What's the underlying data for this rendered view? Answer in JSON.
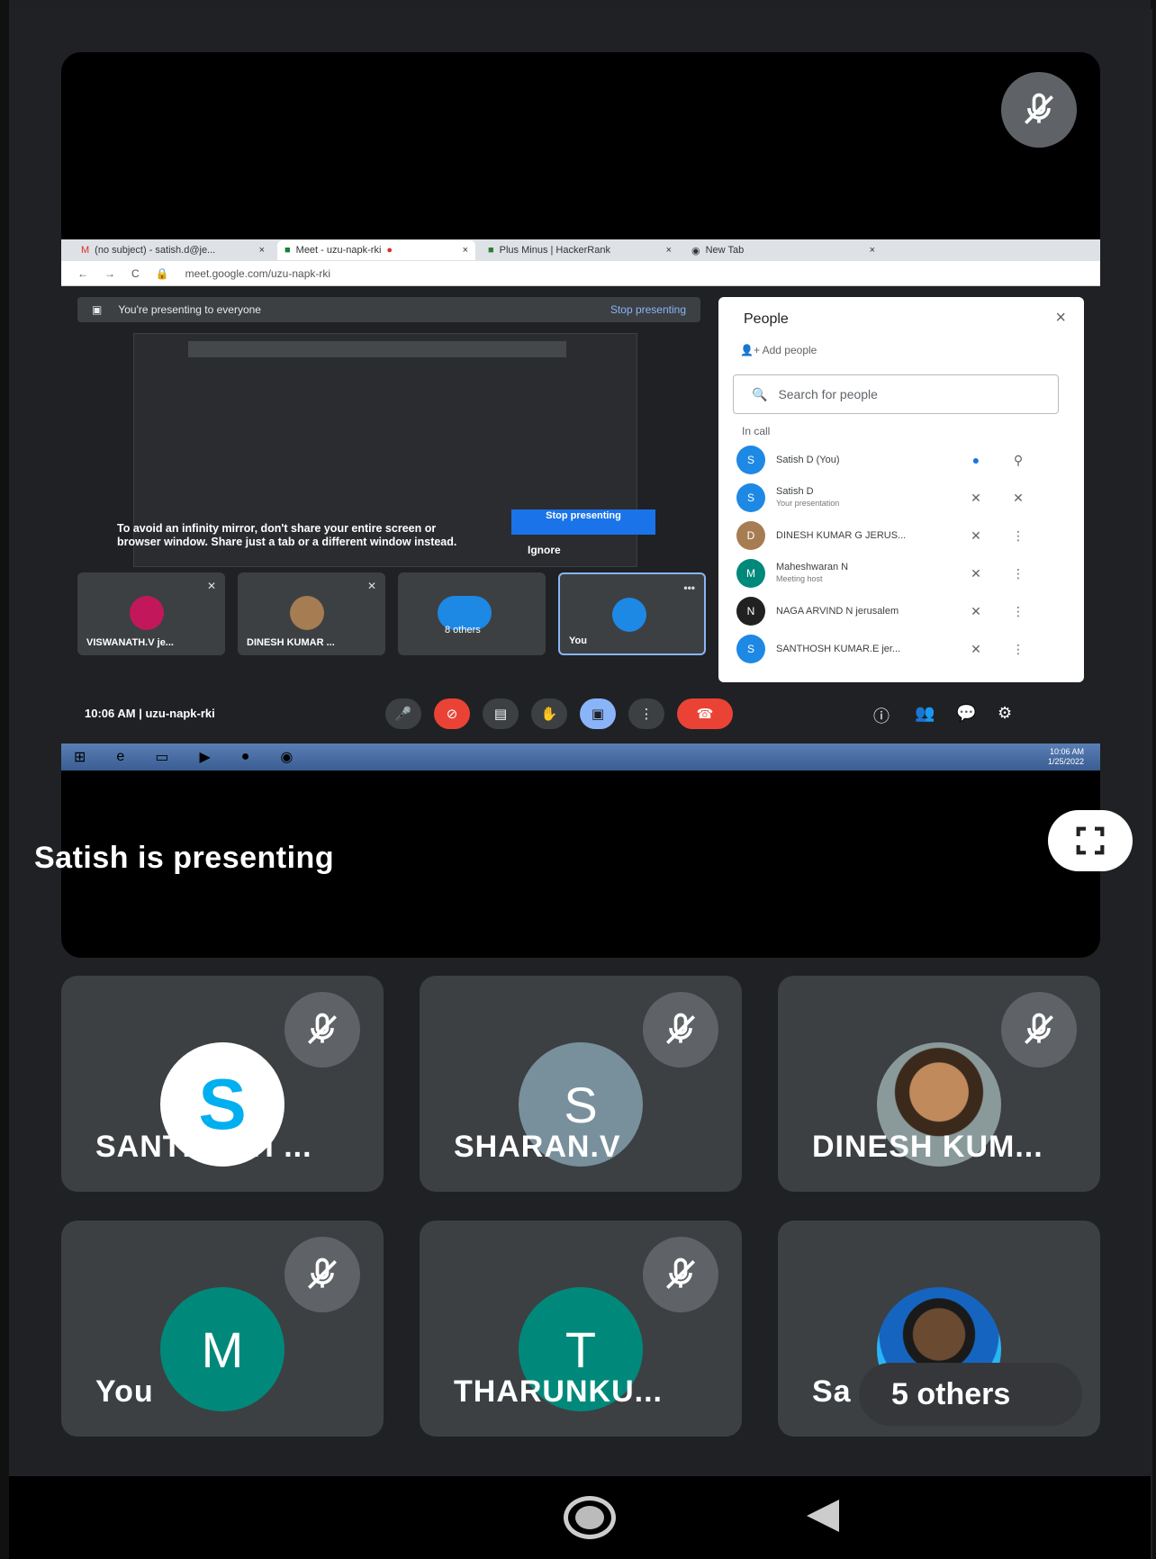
{
  "presentation": {
    "label": "Satish is presenting",
    "icons": {
      "mic": "mic-off-icon",
      "fullscreen": "fullscreen-icon"
    }
  },
  "browser": {
    "tabs": [
      {
        "label": "(no subject) - satish.d@je...",
        "close": "×"
      },
      {
        "label": "Meet - uzu-napk-rki",
        "close": "×"
      },
      {
        "label": "Plus Minus | HackerRank",
        "close": "×"
      },
      {
        "label": "New Tab",
        "close": "×"
      }
    ],
    "url": "meet.google.com/uzu-napk-rki",
    "nav": [
      "←",
      "→",
      "C"
    ]
  },
  "shared_meet": {
    "banner_text": "You're presenting to everyone",
    "banner_stop": "Stop presenting",
    "warning": "To avoid an infinity mirror, don't share your entire screen or browser window. Share just a tab or a different window instead.",
    "stop_button": "Stop presenting",
    "ignore": "Ignore",
    "mini_tiles": [
      {
        "name": "VISWANATH.V je...",
        "avatar_color": "#c2185b"
      },
      {
        "name": "DINESH KUMAR ...",
        "avatar_color": "#a67c52"
      },
      {
        "name": "8 others",
        "avatar_color": "#1e88e5"
      },
      {
        "name": "You",
        "avatar_color": "#1e88e5"
      }
    ],
    "meeting_info": "10:06 AM  |  uzu-napk-rki",
    "taskbar_time": "10:06 AM",
    "taskbar_date": "1/25/2022"
  },
  "people_panel": {
    "title": "People",
    "close": "×",
    "add_people": "Add people",
    "search_placeholder": "Search for people",
    "section": "In call",
    "rows": [
      {
        "name": "Satish D (You)",
        "sub": "",
        "avatar": "S",
        "color": "#1e88e5"
      },
      {
        "name": "Satish D",
        "sub": "Your presentation",
        "avatar": "S",
        "color": "#1e88e5"
      },
      {
        "name": "DINESH KUMAR G JERUS...",
        "sub": "",
        "avatar": "D",
        "color": "#a67c52"
      },
      {
        "name": "Maheshwaran N",
        "sub": "Meeting host",
        "avatar": "M",
        "color": "#00897b"
      },
      {
        "name": "NAGA ARVIND N jerusalem",
        "sub": "",
        "avatar": "N",
        "color": "#212121"
      },
      {
        "name": "SANTHOSH KUMAR.E jer...",
        "sub": "",
        "avatar": "S",
        "color": "#1e88e5"
      }
    ]
  },
  "tiles": [
    {
      "name": "SANTHOSH ...",
      "letter": "S",
      "color": "#ffffff",
      "letter_color": "#00aff0"
    },
    {
      "name": "SHARAN.V",
      "letter": "S",
      "color": "#78909c",
      "letter_color": "#ffffff"
    },
    {
      "name": "DINESH KUM...",
      "letter": "",
      "color": "#a67c52",
      "letter_color": "#ffffff"
    },
    {
      "name": "You",
      "letter": "M",
      "color": "#00897b",
      "letter_color": "#ffffff"
    },
    {
      "name": "THARUNKU...",
      "letter": "T",
      "color": "#00897b",
      "letter_color": "#ffffff"
    },
    {
      "name": "Sa",
      "letter": "",
      "color": "#29b6f6",
      "letter_color": "#ffffff",
      "pill": "5 others"
    }
  ]
}
